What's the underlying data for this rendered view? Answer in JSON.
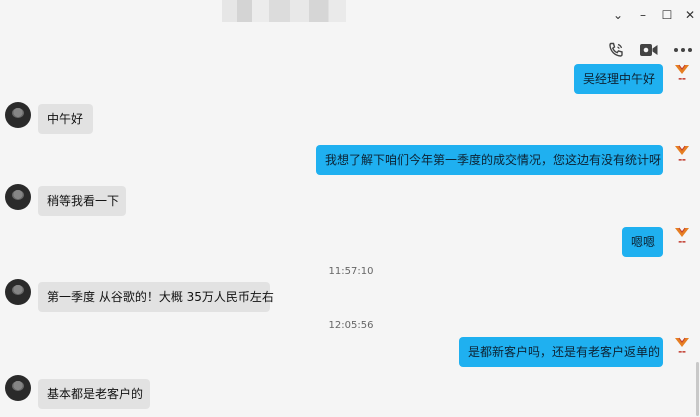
{
  "window": {
    "minimize_glyph": "–",
    "maximize_glyph": "☐",
    "close_glyph": "✕",
    "chevron_glyph": "⌄"
  },
  "toolbar": {
    "icons": [
      "voice-call-icon",
      "video-call-icon",
      "more-icon"
    ]
  },
  "colors": {
    "outgoing_bubble": "#1fb0f0",
    "incoming_bubble": "#e2e2e2",
    "background": "#f5f5f5",
    "logo_red": "#c0392b",
    "logo_orange": "#e67e22"
  },
  "messages": [
    {
      "side": "out",
      "text": "吴经理中午好"
    },
    {
      "side": "in",
      "text": "中午好"
    },
    {
      "side": "out",
      "text": "我想了解下咱们今年第一季度的成交情况，您这边有没有统计呀"
    },
    {
      "side": "in",
      "text": "稍等我看一下"
    },
    {
      "side": "out",
      "text": "嗯嗯"
    },
    {
      "side": "in",
      "text": "第一季度 从谷歌的！大概 35万人民币左右"
    },
    {
      "side": "out",
      "text": "是都新客户吗，还是有老客户返单的"
    },
    {
      "side": "in",
      "text": "基本都是老客户的"
    }
  ],
  "timestamps": [
    "11:57:10",
    "12:05:56"
  ]
}
